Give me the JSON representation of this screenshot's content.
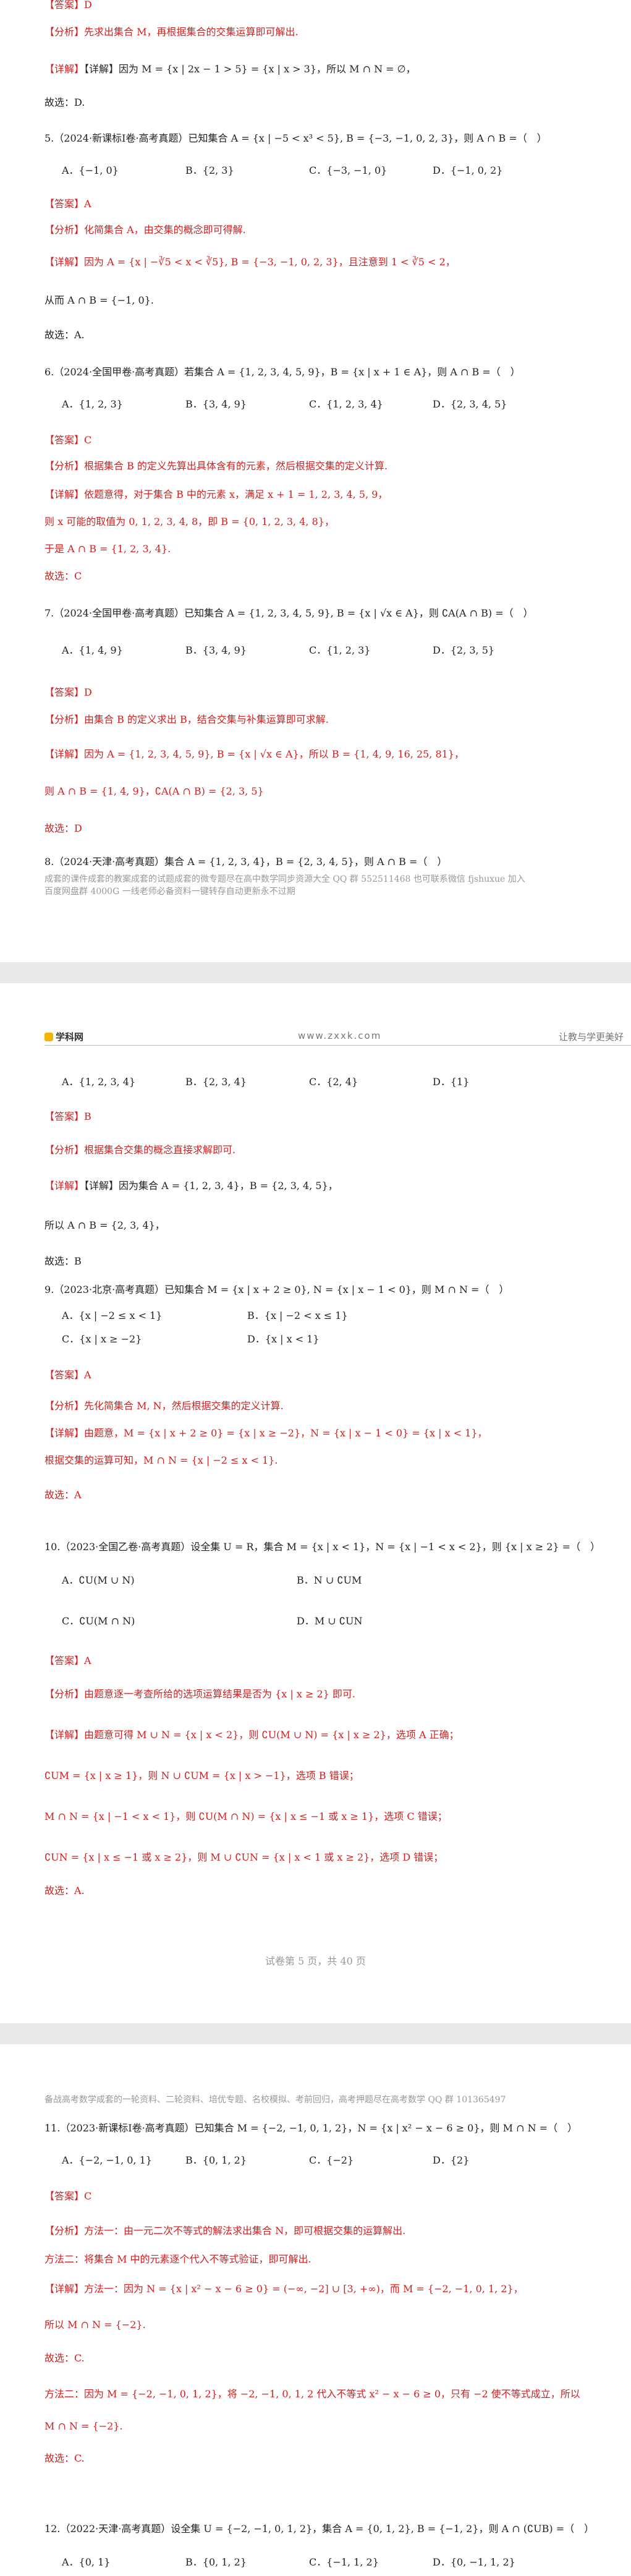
{
  "page1": {
    "lines": [
      "【答案】D",
      "【分析】先求出集合 M，再根据集合的交集运算即可解出.",
      "【详解】因为 M = {x | 2x − 1 > 5} = {x | x > 3}，所以 M ∩ N = ∅，",
      "故选：D.",
      "5.（2024·新课标Ⅰ卷·高考真题）已知集合 A = {x | −5 < x³ < 5}, B = {−3, −1, 0, 2, 3}，则 A ∩ B =（　）",
      "【答案】A",
      "【分析】化简集合 A，由交集的概念即可得解.",
      "【详解】因为 A = {x | −∛5 < x < ∛5}, B = {−3, −1, 0, 2, 3}，且注意到 1 < ∛5 < 2，",
      "从而 A ∩ B = {−1, 0}.",
      "故选：A.",
      "6.（2024·全国甲卷·高考真题）若集合 A = {1, 2, 3, 4, 5, 9}，B = {x | x + 1 ∈ A}，则 A ∩ B =（　）",
      "【答案】C",
      "【分析】根据集合 B 的定义先算出具体含有的元素，然后根据交集的定义计算.",
      "【详解】依题意得，对于集合 B 中的元素 x，满足 x + 1 = 1, 2, 3, 4, 5, 9，",
      "则 x 可能的取值为 0, 1, 2, 3, 4, 8，即 B = {0, 1, 2, 3, 4, 8}，",
      "于是 A ∩ B = {1, 2, 3, 4}.",
      "故选：C",
      "7.（2024·全国甲卷·高考真题）已知集合 A = {1, 2, 3, 4, 5, 9}, B = {x | √x ∈ A}，则 ∁A(A ∩ B) =（　）",
      "【答案】D",
      "【分析】由集合 B 的定义求出 B，结合交集与补集运算即可求解.",
      "【详解】因为 A = {1, 2, 3, 4, 5, 9}, B = {x | √x ∈ A}，所以 B = {1, 4, 9, 16, 25, 81}，",
      "则 A ∩ B = {1, 4, 9}，∁A(A ∩ B) = {2, 3, 5}",
      "故选：D",
      "8.（2024·天津·高考真题）集合 A = {1, 2, 3, 4}，B = {2, 3, 4, 5}，则 A ∩ B =（　）"
    ],
    "options": [
      [
        "A．{−1, 0}",
        "B．{2, 3}",
        "C．{−3, −1, 0}",
        "D．{−1, 0, 2}"
      ],
      [
        "A．{1, 2, 3}",
        "B．{3, 4, 9}",
        "C．{1, 2, 3, 4}",
        "D．{2, 3, 4, 5}"
      ],
      [
        "A．{1, 4, 9}",
        "B．{3, 4, 9}",
        "C．{1, 2, 3}",
        "D．{2, 3, 5}"
      ]
    ],
    "notes": [
      "成套的课件成套的教案成套的试题成套的微专题尽在高中数学同步资源大全 QQ 群 552511468 也可联系微信 fjshuxue 加入",
      "百度网盘群 4000G 一线老师必备资料一键转存自动更新永不过期"
    ]
  },
  "page2": {
    "header": {
      "logo": "学科网",
      "site": "www.zxxk.com",
      "slogan": "让教与学更美好"
    },
    "lines": [
      "【答案】B",
      "【分析】根据集合交集的概念直接求解即可.",
      "【详解】因为集合 A = {1, 2, 3, 4}，B = {2, 3, 4, 5}，",
      "所以 A ∩ B = {2, 3, 4}，",
      "故选：B",
      "9.（2023·北京·高考真题）已知集合 M = {x | x + 2 ≥ 0}, N = {x | x − 1 < 0}，则 M ∩ N =（　）",
      "【答案】A",
      "【分析】先化简集合 M, N，然后根据交集的定义计算.",
      "【详解】由题意，M = {x | x + 2 ≥ 0} = {x | x ≥ −2}，N = {x | x − 1 < 0} = {x | x < 1}，",
      "根据交集的运算可知，M ∩ N = {x | −2 ≤ x < 1}.",
      "故选：A",
      "10.（2023·全国乙卷·高考真题）设全集 U = R，集合 M = {x | x < 1}，N = {x | −1 < x < 2}，则 {x | x ≥ 2} =（　）",
      "【答案】A",
      "【分析】由题意逐一考查所给的选项运算结果是否为 {x | x ≥ 2} 即可.",
      "【详解】由题意可得 M ∪ N = {x | x < 2}，则 ∁U(M ∪ N) = {x | x ≥ 2}，选项 A 正确；",
      "∁UM = {x | x ≥ 1}，则 N ∪ ∁UM = {x | x > −1}，选项 B 错误；",
      "M ∩ N = {x | −1 < x < 1}，则 ∁U(M ∩ N) = {x | x ≤ −1 或 x ≥ 1}，选项 C 错误；",
      "∁UN = {x | x ≤ −1 或 x ≥ 2}，则 M ∪ ∁UN = {x | x < 1 或 x ≥ 2}，选项 D 错误；",
      "故选：A."
    ],
    "options": [
      [
        "A．{1, 2, 3, 4}",
        "B．{2, 3, 4}",
        "C．{2, 4}",
        "D．{1}"
      ],
      [
        "A．{x | −2 ≤ x < 1}",
        "B．{x | −2 < x ≤ 1}"
      ],
      [
        "C．{x | x ≥ −2}",
        "D．{x | x < 1}"
      ],
      [
        "A．∁U(M ∪ N)",
        "B．N ∪ ∁UM"
      ],
      [
        "C．∁U(M ∩ N)",
        "D．M ∪ ∁UN"
      ]
    ],
    "footer": "试卷第 5 页，共 40 页"
  },
  "page3": {
    "note": "备战高考数学成套的一轮资料、二轮资料、培优专题、名校模拟、考前回归，高考押题尽在高考数学 QQ 群 101365497",
    "lines": [
      "11.（2023·新课标Ⅰ卷·高考真题）已知集合 M = {−2, −1, 0, 1, 2}，N = {x | x² − x − 6 ≥ 0}，则 M ∩ N =（　）",
      "【答案】C",
      "【分析】方法一：由一元二次不等式的解法求出集合 N，即可根据交集的运算解出.",
      "方法二：将集合 M 中的元素逐个代入不等式验证，即可解出.",
      "【详解】方法一：因为 N = {x | x² − x − 6 ≥ 0} = (−∞, −2] ∪ [3, +∞)，而 M = {−2, −1, 0, 1, 2}，",
      "所以 M ∩ N = {−2}.",
      "故选：C.",
      "方法二：因为 M = {−2, −1, 0, 1, 2}，将 −2, −1, 0, 1, 2 代入不等式 x² − x − 6 ≥ 0，只有 −2 使不等式成立，所以",
      "M ∩ N = {−2}.",
      "故选：C.",
      "12.（2022·天津·高考真题）设全集 U = {−2, −1, 0, 1, 2}，集合 A = {0, 1, 2}, B = {−1, 2}，则 A ∩ (∁UB) =（　）"
    ],
    "options": [
      [
        "A．{−2, −1, 0, 1}",
        "B．{0, 1, 2}",
        "C．{−2}",
        "D．{2}"
      ],
      [
        "A．{0, 1}",
        "B．{0, 1, 2}",
        "C．{−1, 1, 2}",
        "D．{0, −1, 1, 2}"
      ]
    ]
  }
}
